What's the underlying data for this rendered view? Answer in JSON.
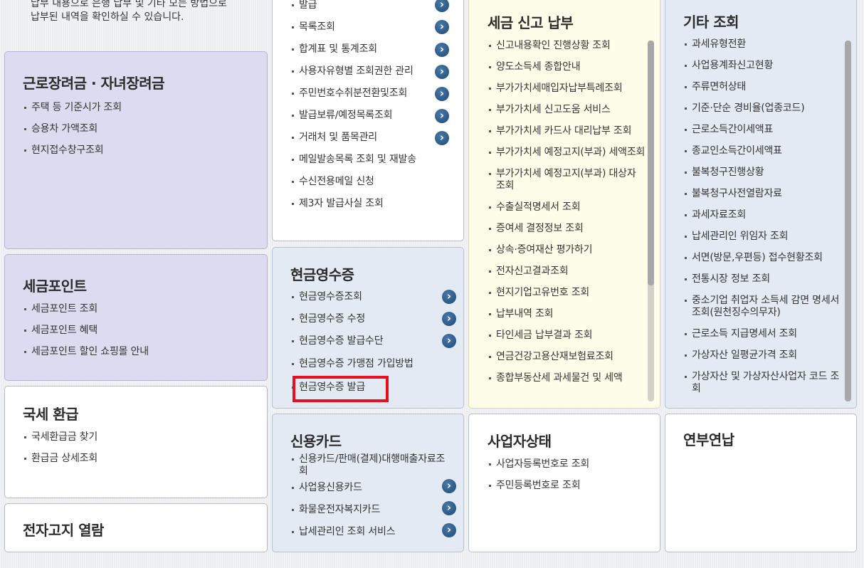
{
  "intro_text": [
    "납부 내용으로 은행 납부 및 기타 모든 방법으로",
    "납부된 내역을 확인하실 수 있습니다."
  ],
  "cards": {
    "work_incentive": {
      "title": "근로장려금 · 자녀장려금",
      "items": [
        "주택 등 기준시가 조회",
        "승용차 가액조회",
        "현지접수창구조회"
      ]
    },
    "tax_point": {
      "title": "세금포인트",
      "items": [
        "세금포인트 조회",
        "세금포인트 혜택",
        "세금포인트 할인 쇼핑몰 안내"
      ]
    },
    "refund": {
      "title": "국세 환급",
      "items": [
        "국세환급금 찾기",
        "환급금 상세조회"
      ]
    },
    "e_notice": {
      "title": "전자고지 열람"
    },
    "invoice": {
      "items": [
        "발급",
        "목록조회",
        "합계표 및 통계조회",
        "사용자유형별 조회권한 관리",
        "주민번호수취분전환및조회",
        "발급보류/예정목록조회",
        "거래처 및 품목관리",
        "메일발송목록 조회 및 재발송",
        "수신전용메일 신청",
        "제3자 발급사실 조회"
      ]
    },
    "cash_receipt": {
      "title": "현금영수증",
      "items": [
        "현금영수증조회",
        "현금영수증 수정",
        "현금영수증 발급수단",
        "현금영수증 가맹점 가입방법",
        "현금영수증 발급"
      ]
    },
    "credit_card": {
      "title": "신용카드",
      "items": [
        "신용카드/판매(결제)대행매출자료조회",
        "사업용신용카드",
        "화물운전자복지카드",
        "납세관리인 조회 서비스"
      ]
    },
    "tax_report": {
      "title": "세금 신고 납부",
      "items": [
        "신고내용확인 진행상황 조회",
        "양도소득세 종합안내",
        "부가가치세매입자납부특례조회",
        "부가가치세 신고도움 서비스",
        "부가가치세 카드사 대리납부 조회",
        "부가가치세 예정고지(부과) 세액조회",
        "부가가치세 예정고지(부과) 대상자 조회",
        "수출실적명세서 조회",
        "증여세 결정정보 조회",
        "상속·증여재산 평가하기",
        "전자신고결과조회",
        "현지기업고유번호 조회",
        "납부내역 조회",
        "타인세금 납부결과 조회",
        "연금건강고용산재보험료조회",
        "종합부동산세 과세물건 및 세액"
      ]
    },
    "biz_status": {
      "title": "사업자상태",
      "items": [
        "사업자등록번호로 조회",
        "주민등록번호로 조회"
      ]
    },
    "other": {
      "title": "기타 조회",
      "items": [
        "과세유형전환",
        "사업용계좌신고현황",
        "주류면허상태",
        "기준·단순 경비율(업종코드)",
        "근로소득간이세액표",
        "종교인소득간이세액표",
        "불복청구진행상황",
        "불복청구사전열람자료",
        "과세자료조회",
        "납세관리인 위임자 조회",
        "서면(방문,우편등) 접수현황조회",
        "전통시장 정보 조회",
        "중소기업 취업자 소득세 감면 명세서 조회(원천징수의무자)",
        "근로소득 지급명세서 조회",
        "가상자산 일평균가격 조회",
        "가상자산 및 가상자산사업자 코드 조회"
      ]
    },
    "installment": {
      "title": "연부연납"
    }
  },
  "colors": {
    "highlight": "#e8101c",
    "lavender": "#dcdcf0",
    "light_blue": "#e3eaf3",
    "light_yellow": "#fdfde9",
    "arrow": "#1e4a78"
  },
  "icons": {
    "arrow": "chevron-right-circle-icon"
  }
}
